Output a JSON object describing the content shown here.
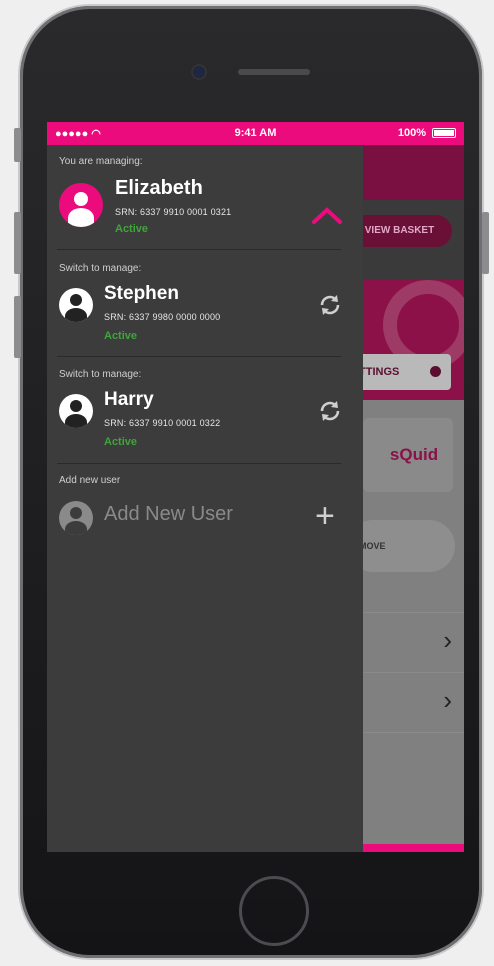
{
  "status_bar": {
    "signal": "●●●●● ",
    "time": "9:41 AM",
    "battery": "100%"
  },
  "background_app": {
    "view_basket_label": "VIEW BASKET",
    "settings_label": "TTINGS",
    "brand_text": "sQuid",
    "move_label": "MOVE"
  },
  "drawer": {
    "current": {
      "section_label": "You are managing:",
      "name": "Elizabeth",
      "srn": "SRN: 6337 9910 0001 0321",
      "status": "Active"
    },
    "others": [
      {
        "section_label": "Switch to manage:",
        "name": "Stephen",
        "srn": "SRN: 6337 9980 0000 0000",
        "status": "Active"
      },
      {
        "section_label": "Switch to manage:",
        "name": "Harry",
        "srn": "SRN: 6337 9910 0001 0322",
        "status": "Active"
      }
    ],
    "add_user": {
      "section_label": "Add new user",
      "label": "Add New User"
    }
  },
  "colors": {
    "accent": "#ec0b7d",
    "drawer_bg": "#3c3c3c",
    "active": "#3ea63a"
  }
}
